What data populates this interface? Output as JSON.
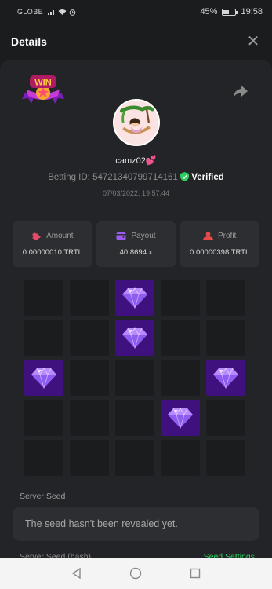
{
  "status_bar": {
    "carrier": "GLOBE",
    "battery_text": "45%",
    "battery_level": 0.45,
    "time": "19:58"
  },
  "header": {
    "title": "Details",
    "close_icon": "close-icon"
  },
  "badge": {
    "text": "WIN"
  },
  "user": {
    "username": "camz02",
    "username_emoji": "💕",
    "betting_id_label": "Betting ID:",
    "betting_id": "54721340799714161",
    "verified_label": "Verified",
    "timestamp": "07/03/2022, 19:57:44"
  },
  "stats": [
    {
      "label": "Amount",
      "value": "0.00000010 TRTL",
      "icon": "money-icon",
      "color": "#e8486a"
    },
    {
      "label": "Payout",
      "value": "40.8694 x",
      "icon": "wallet-icon",
      "color": "#9b5cf0"
    },
    {
      "label": "Profit",
      "value": "0.00000398 TRTL",
      "icon": "coins-icon",
      "color": "#e84a4a"
    }
  ],
  "grid": {
    "rows": 5,
    "cols": 5,
    "cells": [
      0,
      0,
      1,
      0,
      0,
      0,
      0,
      1,
      0,
      0,
      1,
      0,
      0,
      0,
      1,
      0,
      0,
      0,
      1,
      0,
      0,
      0,
      0,
      0,
      0
    ],
    "gem_color": "#3e117e"
  },
  "server_seed": {
    "label": "Server Seed",
    "value": "The seed hasn't been revealed yet."
  },
  "server_seed_hash": {
    "label": "Server Seed (hash)",
    "settings_link": "Seed Settings"
  },
  "colors": {
    "accent_green": "#2ecc5c",
    "panel": "#232427",
    "background": "#1b1c1e"
  }
}
